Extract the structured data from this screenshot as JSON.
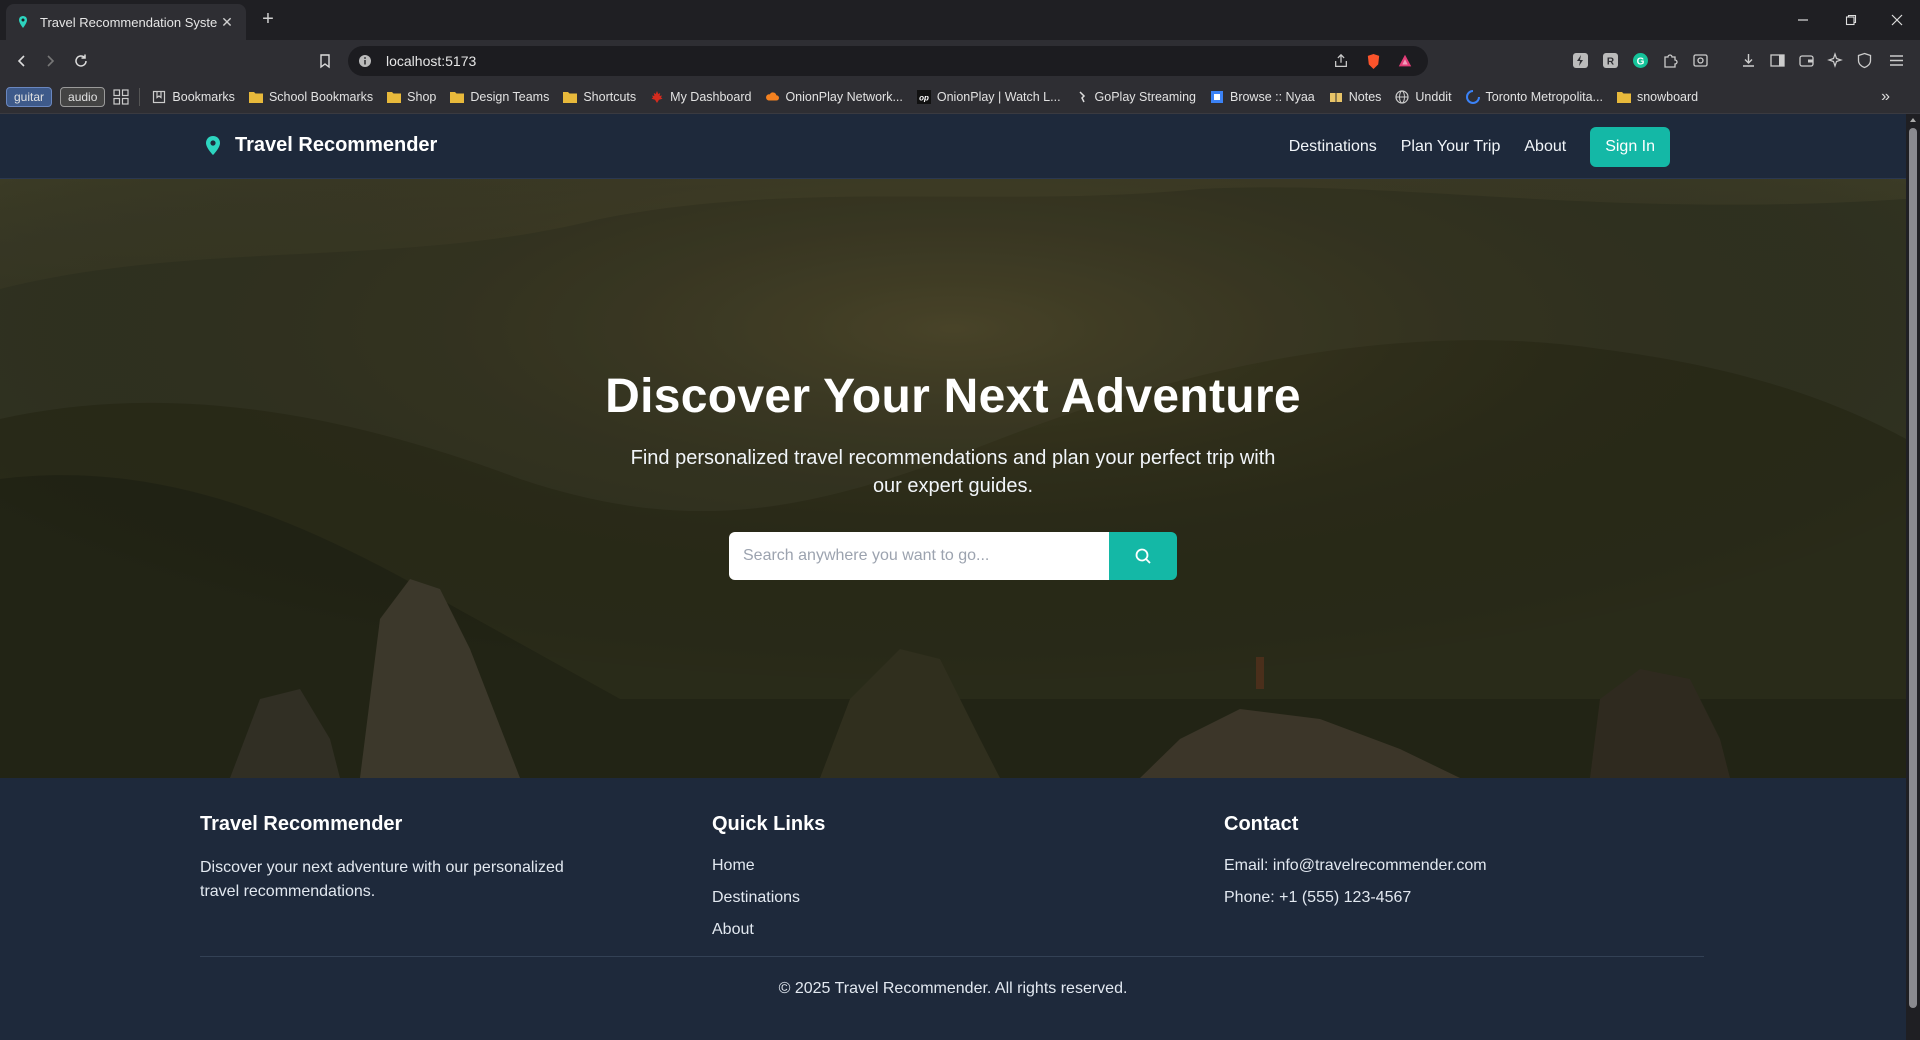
{
  "browser": {
    "tab_title": "Travel Recommendation System",
    "url": "localhost:5173",
    "bookmark_chips": [
      "guitar",
      "audio"
    ],
    "bookmarks": [
      {
        "label": "Bookmarks",
        "icon": "bookmarks-icon"
      },
      {
        "label": "School Bookmarks",
        "icon": "folder-icon"
      },
      {
        "label": "Shop",
        "icon": "folder-icon"
      },
      {
        "label": "Design Teams",
        "icon": "folder-icon"
      },
      {
        "label": "Shortcuts",
        "icon": "folder-icon"
      },
      {
        "label": "My Dashboard",
        "icon": "maple-leaf-icon"
      },
      {
        "label": "OnionPlay Network...",
        "icon": "cloud-icon"
      },
      {
        "label": "OnionPlay | Watch L...",
        "icon": "op-icon"
      },
      {
        "label": "GoPlay Streaming",
        "icon": "goplay-icon"
      },
      {
        "label": "Browse :: Nyaa",
        "icon": "nyaa-icon"
      },
      {
        "label": "Notes",
        "icon": "notes-icon"
      },
      {
        "label": "Unddit",
        "icon": "globe-icon"
      },
      {
        "label": "Toronto Metropolita...",
        "icon": "tmu-icon"
      },
      {
        "label": "snowboard",
        "icon": "folder-icon"
      }
    ],
    "colors": {
      "folder": "#e8b93b",
      "accent": "#14b8a6"
    }
  },
  "site": {
    "brand": "Travel Recommender",
    "nav": {
      "destinations": "Destinations",
      "plan": "Plan Your Trip",
      "about": "About",
      "signin": "Sign In"
    },
    "hero": {
      "title": "Discover Your Next Adventure",
      "subtitle": "Find personalized travel recommendations and plan your perfect trip with our expert guides.",
      "search_placeholder": "Search anywhere you want to go..."
    },
    "footer": {
      "about_title": "Travel Recommender",
      "about_text": "Discover your next adventure with our personalized travel recommendations.",
      "links_title": "Quick Links",
      "links": [
        "Home",
        "Destinations",
        "About"
      ],
      "contact_title": "Contact",
      "email": "Email: info@travelrecommender.com",
      "phone": "Phone: +1 (555) 123-4567",
      "copyright": "© 2025 Travel Recommender. All rights reserved."
    }
  }
}
